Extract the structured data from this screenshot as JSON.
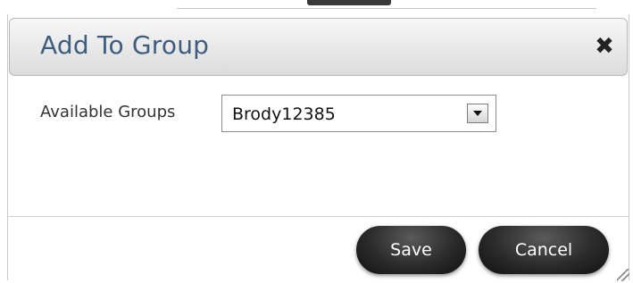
{
  "dialog": {
    "title": "Add To Group",
    "close_symbol": "✖",
    "close_icon": "close-icon"
  },
  "form": {
    "available_groups_label": "Available Groups",
    "selected_group": "Brody12385",
    "dropdown_icon": "chevron-down-icon"
  },
  "buttons": {
    "save_label": "Save",
    "cancel_label": "Cancel"
  },
  "colors": {
    "title_text": "#3d5d7e",
    "titlebar_bg": "#e6e6e6",
    "button_bg": "#1e1e1e",
    "button_text": "#ffffff"
  }
}
